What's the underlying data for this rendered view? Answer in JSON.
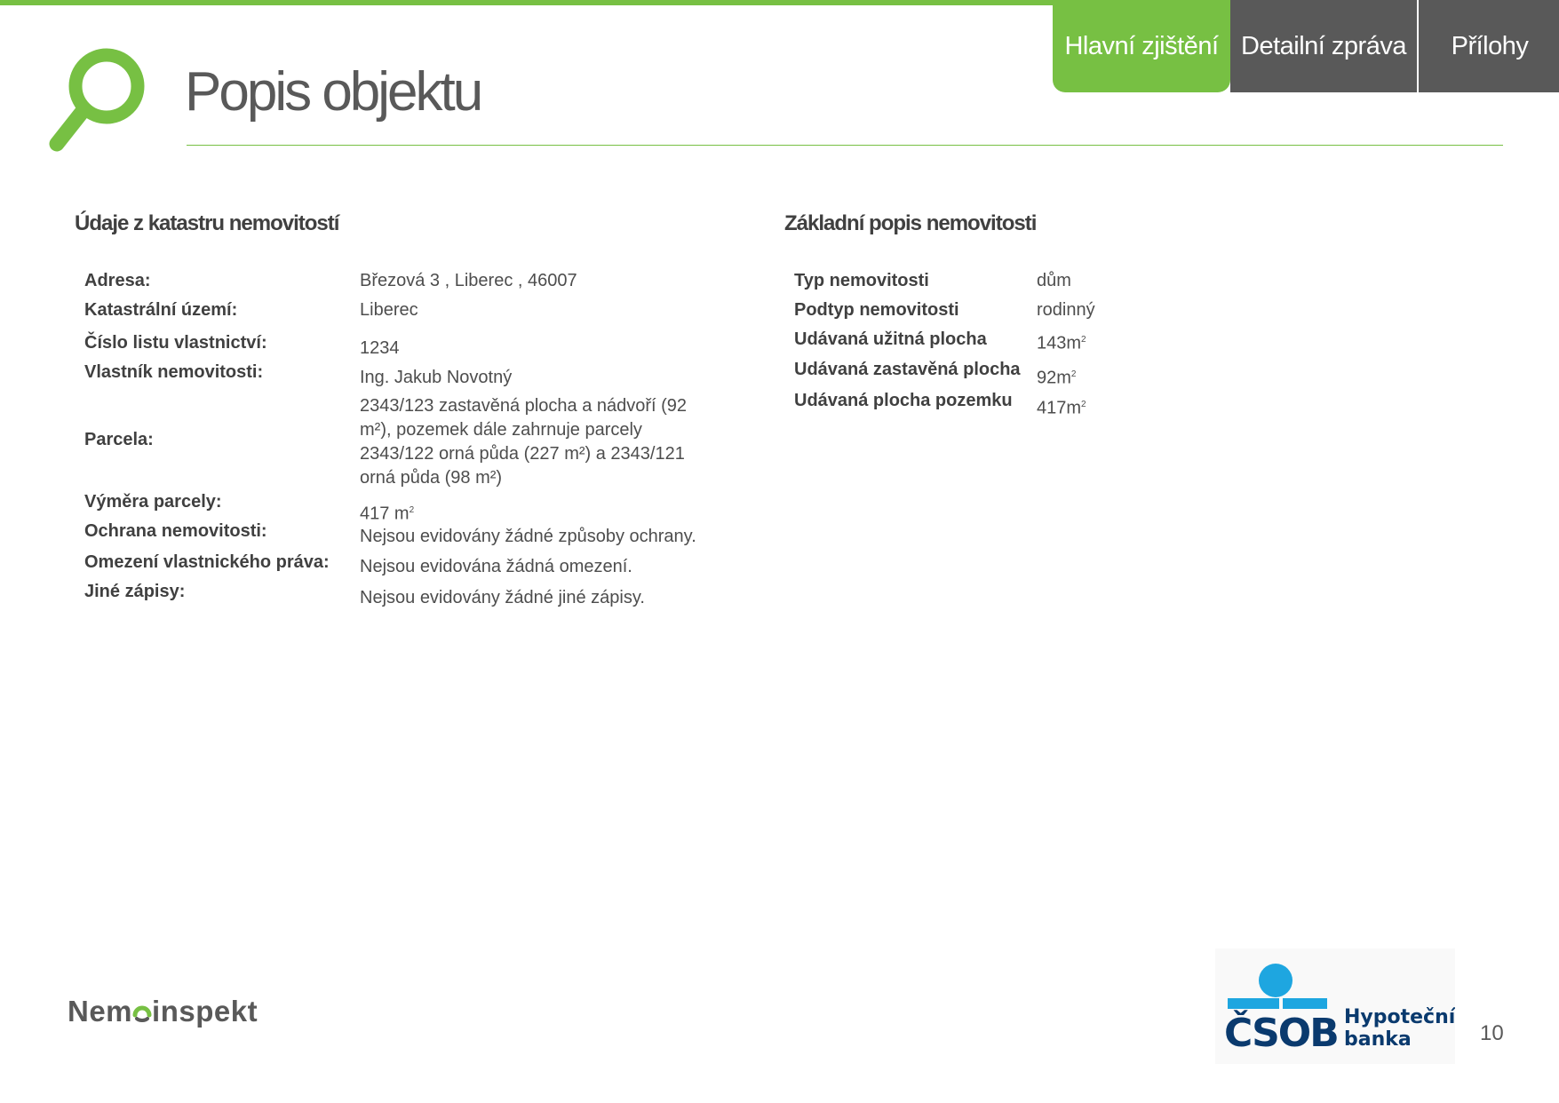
{
  "tabs": [
    {
      "label": "Hlavní zjištění",
      "active": true
    },
    {
      "label": "Detailní zpráva",
      "active": false
    },
    {
      "label": "Přílohy",
      "active": false
    }
  ],
  "page": {
    "title": "Popis objektu",
    "number": "10",
    "accent_color": "#77c043",
    "tab_inactive_color": "#595959"
  },
  "cadastre": {
    "heading": "Údaje z katastru nemovitostí",
    "rows": [
      {
        "label": "Adresa:",
        "value": "Březová 3 , Liberec , 46007"
      },
      {
        "label": "Katastrální území:",
        "value": "Liberec"
      },
      {
        "label": "Číslo listu vlastnictví:",
        "value": "1234"
      },
      {
        "label": "Vlastník nemovitosti:",
        "value": "Ing. Jakub Novotný"
      },
      {
        "label": "Parcela:",
        "value": "2343/123 zastavěná plocha a nádvoří (92 m²), pozemek dále zahrnuje parcely 2343/122 orná půda (227 m²) a 2343/121 orná půda (98 m²)"
      },
      {
        "label": "Výměra parcely:",
        "value": "417 m",
        "unit_sup": "2"
      },
      {
        "label": "Ochrana nemovitosti:",
        "value": "Nejsou evidovány žádné způsoby ochrany."
      },
      {
        "label": "Omezení vlastnického práva:",
        "value": "Nejsou evidována žádná omezení."
      },
      {
        "label": "Jiné zápisy:",
        "value": "Nejsou evidovány žádné jiné zápisy."
      }
    ]
  },
  "basic": {
    "heading": "Základní popis nemovitosti",
    "rows": [
      {
        "label": "Typ nemovitosti",
        "value": "dům"
      },
      {
        "label": "Podtyp nemovitosti",
        "value": "rodinný"
      },
      {
        "label": "Udávaná užitná plocha",
        "value": "143m",
        "unit_sup": "2"
      },
      {
        "label": "Udávaná zastavěná plocha",
        "value": "92m",
        "unit_sup": "2"
      },
      {
        "label": "Udávaná plocha pozemku",
        "value": "417m",
        "unit_sup": "2"
      }
    ]
  },
  "footer": {
    "nemo_logo_prefix": "Nem",
    "nemo_logo_suffix": "inspekt",
    "bank_logo": "ČSOB",
    "bank_line1": "Hypoteční",
    "bank_line2": "banka",
    "bank_color": "#0a3a6e",
    "bank_accent": "#1ea6e0"
  }
}
